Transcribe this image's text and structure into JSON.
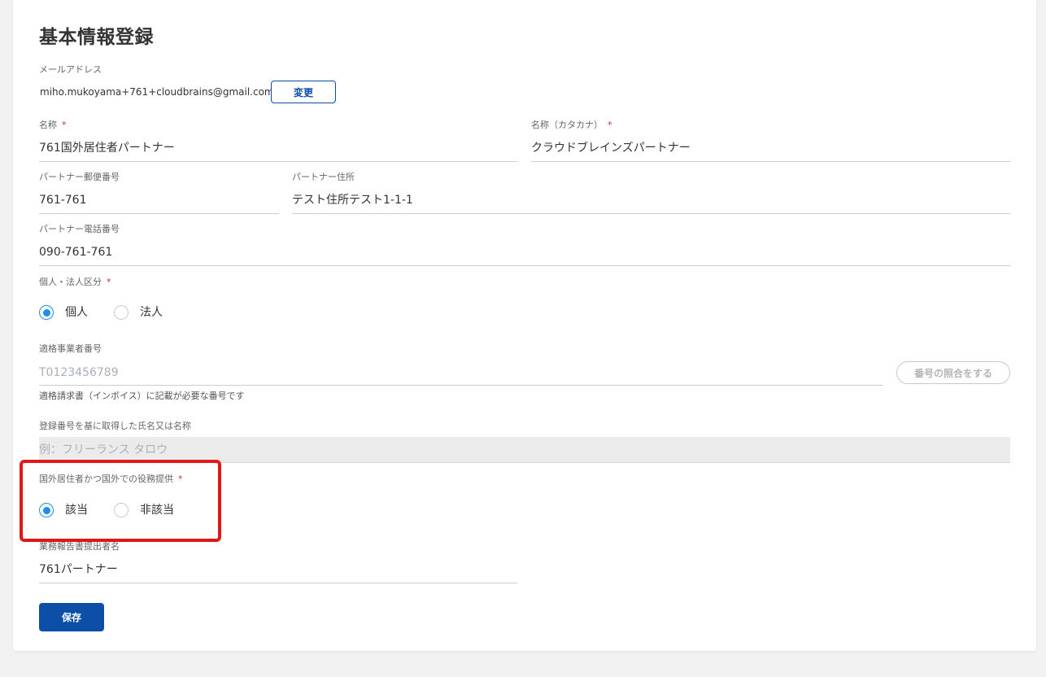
{
  "page": {
    "title": "基本情報登録"
  },
  "email": {
    "label": "メールアドレス",
    "value": "miho.mukoyama+761+cloudbrains@gmail.com",
    "change_label": "変更"
  },
  "name": {
    "label": "名称",
    "required_mark": "*",
    "value": "761国外居住者パートナー"
  },
  "name_kana": {
    "label": "名称（カタカナ）",
    "required_mark": "*",
    "value": "クラウドブレインズパートナー"
  },
  "postal": {
    "label": "パートナー郵便番号",
    "value": "761-761"
  },
  "address": {
    "label": "パートナー住所",
    "value": "テスト住所テスト1-1-1"
  },
  "phone": {
    "label": "パートナー電話番号",
    "value": "090-761-761"
  },
  "entity_type": {
    "label": "個人・法人区分",
    "required_mark": "*",
    "options": [
      "個人",
      "法人"
    ],
    "selected": "個人"
  },
  "invoice_number": {
    "label": "適格事業者番号",
    "placeholder": "T0123456789",
    "verify_label": "番号の照合をする",
    "helper": "適格請求書（インボイス）に記載が必要な番号です"
  },
  "registered_name": {
    "label": "登録番号を基に取得した氏名又は名称",
    "placeholder": "例：フリーランス タロウ"
  },
  "overseas": {
    "label": "国外居住者かつ国外での役務提供",
    "required_mark": "*",
    "options": [
      "該当",
      "非該当"
    ],
    "selected": "該当"
  },
  "report_submitter": {
    "label": "業務報告書提出者名",
    "value": "761パートナー"
  },
  "save": {
    "label": "保存"
  },
  "colors": {
    "primary": "#0d4fa6",
    "radio_active": "#1b8ef0",
    "required": "#d32f2f",
    "highlight": "#e01818"
  }
}
